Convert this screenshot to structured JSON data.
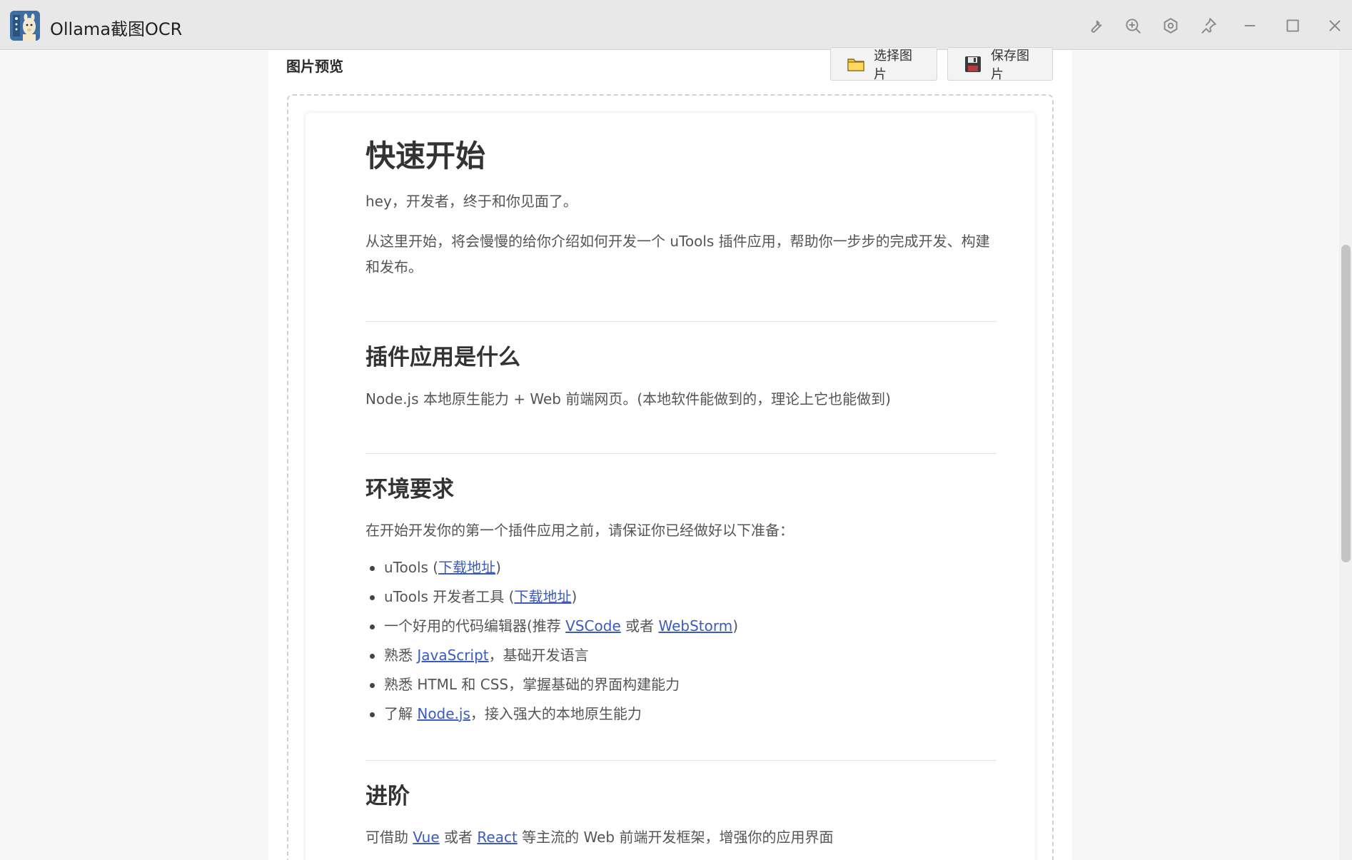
{
  "app": {
    "title": "Ollama截图OCR"
  },
  "toolbar": {
    "icons": [
      "wrench-icon",
      "zoom-in-icon",
      "settings-icon",
      "pin-icon",
      "minimize-icon",
      "maximize-icon",
      "close-icon"
    ]
  },
  "panel": {
    "title": "图片预览",
    "select_label": "选择图片",
    "save_label": "保存图片"
  },
  "doc": {
    "h1": "快速开始",
    "p1": "hey，开发者，终于和你见面了。",
    "p2": "从这里开始，将会慢慢的给你介绍如何开发一个 uTools 插件应用，帮助你一步步的完成开发、构建和发布。",
    "h2_what": "插件应用是什么",
    "p_what": "Node.js 本地原生能力 + Web 前端网页。(本地软件能做到的，理论上它也能做到)",
    "h2_env": "环境要求",
    "p_env": "在开始开发你的第一个插件应用之前，请保证你已经做好以下准备：",
    "list": [
      {
        "pre": "uTools (",
        "link": "下载地址",
        "post": ")"
      },
      {
        "pre": "uTools 开发者工具 (",
        "link": "下载地址",
        "post": ")"
      },
      {
        "pre": "一个好用的代码编辑器(推荐 ",
        "link": "VSCode",
        "mid": " 或者 ",
        "link2": "WebStorm",
        "post": ")"
      },
      {
        "pre": "熟悉 ",
        "link": "JavaScript",
        "post": "，基础开发语言"
      },
      {
        "pre": "熟悉 HTML 和 CSS，掌握基础的界面构建能力"
      },
      {
        "pre": "了解 ",
        "link": "Node.js",
        "post": "，接入强大的本地原生能力"
      }
    ],
    "h2_adv": "进阶",
    "p_adv_pre": "可借助 ",
    "p_adv_link1": "Vue",
    "p_adv_mid": " 或者 ",
    "p_adv_link2": "React",
    "p_adv_post": " 等主流的 Web 前端开发框架，增强你的应用界面"
  },
  "colors": {
    "link": "#3b5bbf",
    "titlebar": "#e8e8e8"
  }
}
